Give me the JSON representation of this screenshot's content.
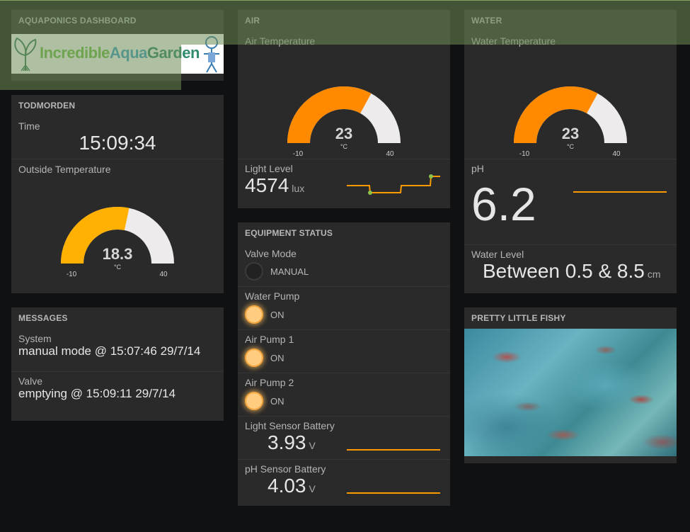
{
  "colors": {
    "gauge_orange": "#ff8a00",
    "gauge_yellow": "#ffb000",
    "gauge_empty": "#edebeb",
    "sparkline": "#ff9900",
    "sparkline_dot": "#8bc34a"
  },
  "header": {
    "title": "AQUAPONICS DASHBOARD",
    "logo_text_1": "Incredible",
    "logo_text_2": "Aqua",
    "logo_text_3": "Garden"
  },
  "todmorden": {
    "title": "TODMORDEN",
    "time_label": "Time",
    "time_value": "15:09:34",
    "outside_temp_label": "Outside Temperature",
    "outside_temp": {
      "value": 18.3,
      "display": "18.3",
      "unit": "°C",
      "min": -10,
      "max": 40,
      "min_label": "-10",
      "max_label": "40"
    }
  },
  "messages": {
    "title": "MESSAGES",
    "items": [
      {
        "label": "System",
        "text": "manual mode @ 15:07:46 29/7/14"
      },
      {
        "label": "Valve",
        "text": "emptying @ 15:09:11 29/7/14"
      }
    ]
  },
  "air": {
    "title": "AIR",
    "temp_label": "Air Temperature",
    "temp": {
      "value": 23,
      "display": "23",
      "unit": "°C",
      "min": -10,
      "max": 40,
      "min_label": "-10",
      "max_label": "40"
    },
    "light_label": "Light Level",
    "light_value": "4574",
    "light_unit": "lux"
  },
  "equipment": {
    "title": "EQUIPMENT STATUS",
    "indicators": [
      {
        "label": "Valve Mode",
        "state": "MANUAL",
        "on": false
      },
      {
        "label": "Water Pump",
        "state": "ON",
        "on": true
      },
      {
        "label": "Air Pump 1",
        "state": "ON",
        "on": true
      },
      {
        "label": "Air Pump 2",
        "state": "ON",
        "on": true
      }
    ],
    "light_battery_label": "Light Sensor Battery",
    "light_battery_value": "3.93",
    "light_battery_unit": "V",
    "ph_battery_label": "pH Sensor Battery",
    "ph_battery_value": "4.03",
    "ph_battery_unit": "V"
  },
  "water": {
    "title": "WATER",
    "temp_label": "Water Temperature",
    "temp": {
      "value": 23,
      "display": "23",
      "unit": "°C",
      "min": -10,
      "max": 40,
      "min_label": "-10",
      "max_label": "40"
    },
    "ph_label": "pH",
    "ph_value": "6.2",
    "level_label": "Water Level",
    "level_value": "Between 0.5 & 8.5",
    "level_unit": "cm"
  },
  "fishy": {
    "title": "PRETTY LITTLE FISHY"
  }
}
